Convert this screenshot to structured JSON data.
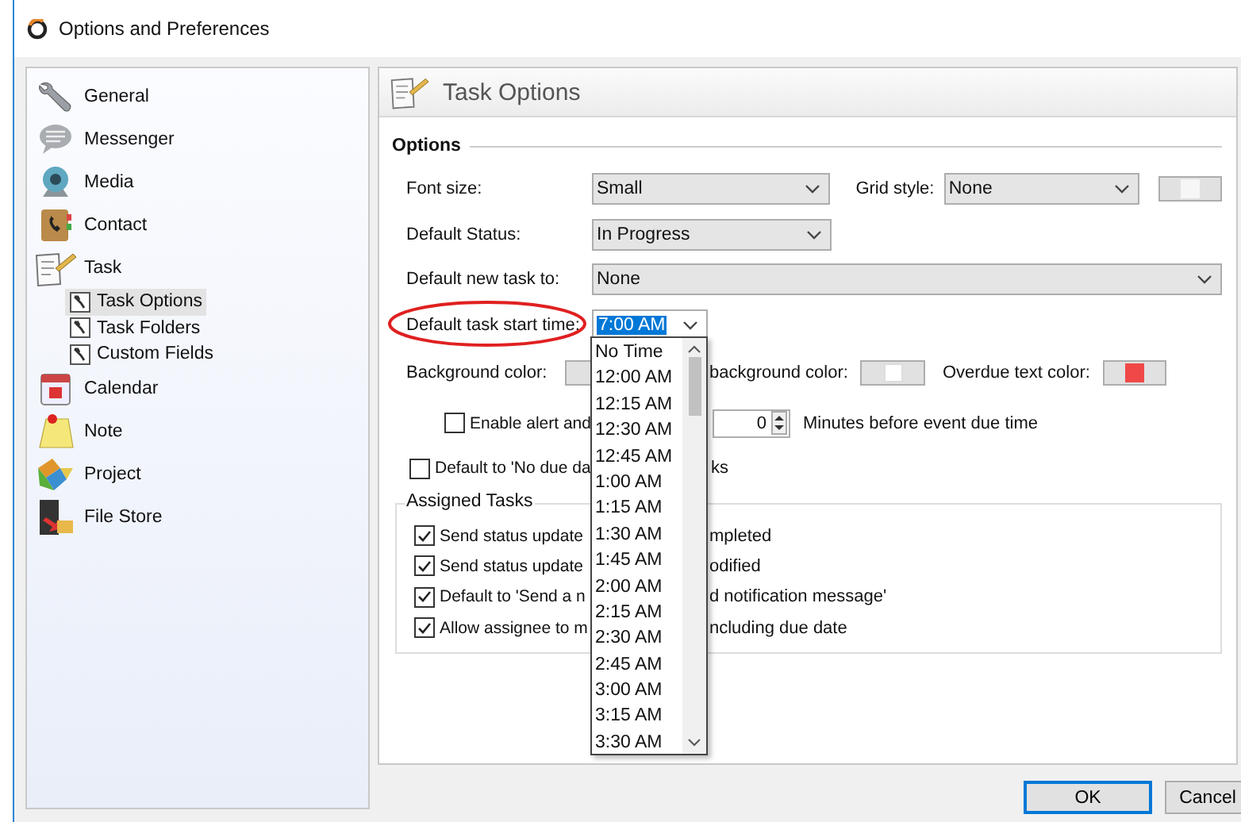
{
  "window": {
    "title": "Options and Preferences"
  },
  "sidebar": {
    "items": [
      {
        "label": "General",
        "selected": false
      },
      {
        "label": "Messenger",
        "selected": false
      },
      {
        "label": "Media",
        "selected": false
      },
      {
        "label": "Contact",
        "selected": false
      },
      {
        "label": "Task",
        "selected": false,
        "children": [
          {
            "label": "Task Options",
            "selected": true
          },
          {
            "label": "Task Folders",
            "selected": false
          },
          {
            "label": "Custom Fields",
            "selected": false
          }
        ]
      },
      {
        "label": "Calendar",
        "selected": false
      },
      {
        "label": "Note",
        "selected": false
      },
      {
        "label": "Project",
        "selected": false
      },
      {
        "label": "File Store",
        "selected": false
      }
    ]
  },
  "panel": {
    "title": "Task Options",
    "section": "Options",
    "font_size": {
      "label": "Font size:",
      "value": "Small"
    },
    "grid_style": {
      "label": "Grid style:",
      "value": "None",
      "color": "#f6f6f6"
    },
    "default_status": {
      "label": "Default Status:",
      "value": "In Progress"
    },
    "default_new_task": {
      "label": "Default new task to:",
      "value": "None"
    },
    "start_time": {
      "label": "Default task start time:",
      "value": "7:00 AM"
    },
    "background_color": {
      "label": "Background color:"
    },
    "second_background_color": {
      "label": "background color:",
      "color": "#ffffff"
    },
    "overdue_text_color": {
      "label": "Overdue text color:",
      "color": "#f04848"
    },
    "alert": {
      "label": "Enable alert and",
      "checked": false,
      "minutes": "0",
      "suffix": "Minutes before event due time"
    },
    "no_due_date": {
      "label": "Default to 'No due da",
      "label_end": "ks",
      "checked": false
    },
    "assigned_tasks": {
      "title": "Assigned Tasks",
      "items": [
        {
          "label": "Send status update",
          "label_end": "mpleted",
          "checked": true
        },
        {
          "label": "Send status update",
          "label_end": "odified",
          "checked": true
        },
        {
          "label": "Default to 'Send a n",
          "label_end": "d notification message'",
          "checked": true
        },
        {
          "label": "Allow assignee to m",
          "label_end": "ncluding due date",
          "checked": true
        }
      ]
    },
    "time_list": {
      "items": [
        "No Time",
        "12:00 AM",
        "12:15 AM",
        "12:30 AM",
        "12:45 AM",
        "1:00 AM",
        "1:15 AM",
        "1:30 AM",
        "1:45 AM",
        "2:00 AM",
        "2:15 AM",
        "2:30 AM",
        "2:45 AM",
        "3:00 AM",
        "3:15 AM",
        "3:30 AM"
      ]
    }
  },
  "buttons": [
    {
      "label": "OK",
      "default": true
    },
    {
      "label": "Cancel",
      "default": false
    }
  ]
}
